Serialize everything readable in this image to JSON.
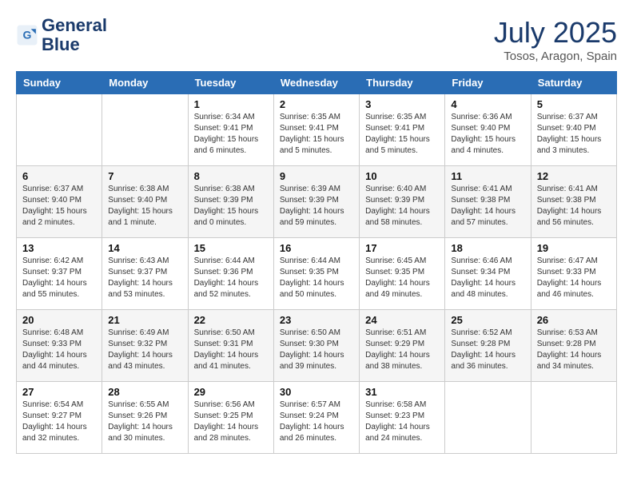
{
  "header": {
    "logo_line1": "General",
    "logo_line2": "Blue",
    "month_year": "July 2025",
    "location": "Tosos, Aragon, Spain"
  },
  "days_of_week": [
    "Sunday",
    "Monday",
    "Tuesday",
    "Wednesday",
    "Thursday",
    "Friday",
    "Saturday"
  ],
  "weeks": [
    [
      {
        "day": "",
        "info": ""
      },
      {
        "day": "",
        "info": ""
      },
      {
        "day": "1",
        "info": "Sunrise: 6:34 AM\nSunset: 9:41 PM\nDaylight: 15 hours and 6 minutes."
      },
      {
        "day": "2",
        "info": "Sunrise: 6:35 AM\nSunset: 9:41 PM\nDaylight: 15 hours and 5 minutes."
      },
      {
        "day": "3",
        "info": "Sunrise: 6:35 AM\nSunset: 9:41 PM\nDaylight: 15 hours and 5 minutes."
      },
      {
        "day": "4",
        "info": "Sunrise: 6:36 AM\nSunset: 9:40 PM\nDaylight: 15 hours and 4 minutes."
      },
      {
        "day": "5",
        "info": "Sunrise: 6:37 AM\nSunset: 9:40 PM\nDaylight: 15 hours and 3 minutes."
      }
    ],
    [
      {
        "day": "6",
        "info": "Sunrise: 6:37 AM\nSunset: 9:40 PM\nDaylight: 15 hours and 2 minutes."
      },
      {
        "day": "7",
        "info": "Sunrise: 6:38 AM\nSunset: 9:40 PM\nDaylight: 15 hours and 1 minute."
      },
      {
        "day": "8",
        "info": "Sunrise: 6:38 AM\nSunset: 9:39 PM\nDaylight: 15 hours and 0 minutes."
      },
      {
        "day": "9",
        "info": "Sunrise: 6:39 AM\nSunset: 9:39 PM\nDaylight: 14 hours and 59 minutes."
      },
      {
        "day": "10",
        "info": "Sunrise: 6:40 AM\nSunset: 9:39 PM\nDaylight: 14 hours and 58 minutes."
      },
      {
        "day": "11",
        "info": "Sunrise: 6:41 AM\nSunset: 9:38 PM\nDaylight: 14 hours and 57 minutes."
      },
      {
        "day": "12",
        "info": "Sunrise: 6:41 AM\nSunset: 9:38 PM\nDaylight: 14 hours and 56 minutes."
      }
    ],
    [
      {
        "day": "13",
        "info": "Sunrise: 6:42 AM\nSunset: 9:37 PM\nDaylight: 14 hours and 55 minutes."
      },
      {
        "day": "14",
        "info": "Sunrise: 6:43 AM\nSunset: 9:37 PM\nDaylight: 14 hours and 53 minutes."
      },
      {
        "day": "15",
        "info": "Sunrise: 6:44 AM\nSunset: 9:36 PM\nDaylight: 14 hours and 52 minutes."
      },
      {
        "day": "16",
        "info": "Sunrise: 6:44 AM\nSunset: 9:35 PM\nDaylight: 14 hours and 50 minutes."
      },
      {
        "day": "17",
        "info": "Sunrise: 6:45 AM\nSunset: 9:35 PM\nDaylight: 14 hours and 49 minutes."
      },
      {
        "day": "18",
        "info": "Sunrise: 6:46 AM\nSunset: 9:34 PM\nDaylight: 14 hours and 48 minutes."
      },
      {
        "day": "19",
        "info": "Sunrise: 6:47 AM\nSunset: 9:33 PM\nDaylight: 14 hours and 46 minutes."
      }
    ],
    [
      {
        "day": "20",
        "info": "Sunrise: 6:48 AM\nSunset: 9:33 PM\nDaylight: 14 hours and 44 minutes."
      },
      {
        "day": "21",
        "info": "Sunrise: 6:49 AM\nSunset: 9:32 PM\nDaylight: 14 hours and 43 minutes."
      },
      {
        "day": "22",
        "info": "Sunrise: 6:50 AM\nSunset: 9:31 PM\nDaylight: 14 hours and 41 minutes."
      },
      {
        "day": "23",
        "info": "Sunrise: 6:50 AM\nSunset: 9:30 PM\nDaylight: 14 hours and 39 minutes."
      },
      {
        "day": "24",
        "info": "Sunrise: 6:51 AM\nSunset: 9:29 PM\nDaylight: 14 hours and 38 minutes."
      },
      {
        "day": "25",
        "info": "Sunrise: 6:52 AM\nSunset: 9:28 PM\nDaylight: 14 hours and 36 minutes."
      },
      {
        "day": "26",
        "info": "Sunrise: 6:53 AM\nSunset: 9:28 PM\nDaylight: 14 hours and 34 minutes."
      }
    ],
    [
      {
        "day": "27",
        "info": "Sunrise: 6:54 AM\nSunset: 9:27 PM\nDaylight: 14 hours and 32 minutes."
      },
      {
        "day": "28",
        "info": "Sunrise: 6:55 AM\nSunset: 9:26 PM\nDaylight: 14 hours and 30 minutes."
      },
      {
        "day": "29",
        "info": "Sunrise: 6:56 AM\nSunset: 9:25 PM\nDaylight: 14 hours and 28 minutes."
      },
      {
        "day": "30",
        "info": "Sunrise: 6:57 AM\nSunset: 9:24 PM\nDaylight: 14 hours and 26 minutes."
      },
      {
        "day": "31",
        "info": "Sunrise: 6:58 AM\nSunset: 9:23 PM\nDaylight: 14 hours and 24 minutes."
      },
      {
        "day": "",
        "info": ""
      },
      {
        "day": "",
        "info": ""
      }
    ]
  ]
}
